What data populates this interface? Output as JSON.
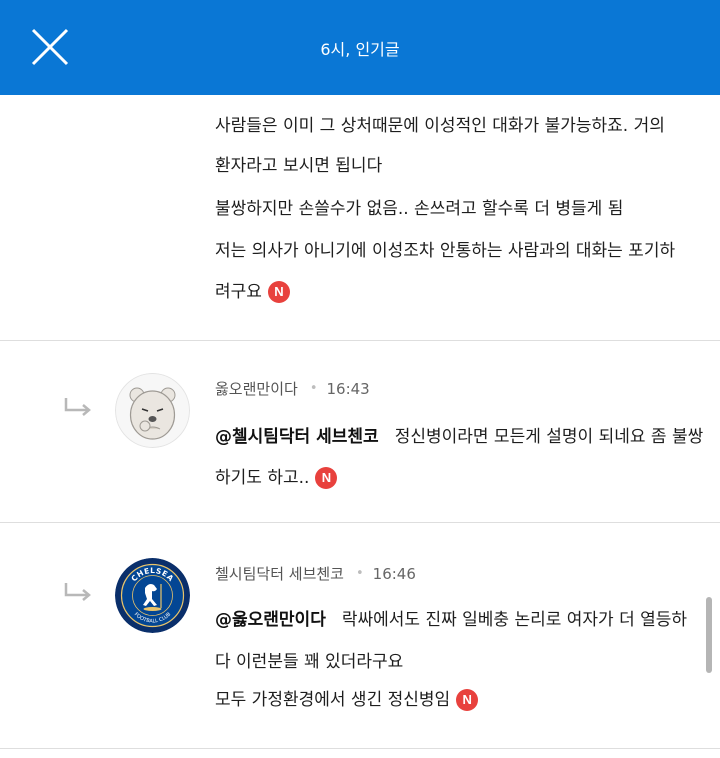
{
  "header": {
    "title": "6시, 인기글",
    "close_icon": "close-icon"
  },
  "comments": [
    {
      "lines": [
        "사람들은 이미 그 상처때문에 이성적인 대화가 불가능하죠. 거의",
        "환자라고 보시면 됩니다",
        "불쌍하지만 손쓸수가 없음.. 손쓰려고 할수록 더 병들게 됨",
        "저는 의사가 아니기에 이성조차 안통하는 사람과의 대화는 포기하",
        "려구요"
      ],
      "new_badge": "N"
    },
    {
      "author": "옳오랜만이다",
      "time": "16:43",
      "avatar": "character-avatar",
      "mention": "@첼시팀닥터 세브첸코",
      "lines": [
        "정신병이라면 모든게 설명이 되네요 좀 불쌍",
        "하기도 하고.."
      ],
      "new_badge": "N"
    },
    {
      "author": "첼시팀닥터 세브첸코",
      "time": "16:46",
      "avatar": "chelsea-crest-avatar",
      "avatar_text": "CHELSEA FOOTBALL CLUB",
      "mention": "@옳오랜만이다",
      "lines": [
        "락싸에서도 진짜 일베충 논리로 여자가 더 열등하",
        "다 이런분들 꽤 있더라구요",
        "모두 가정환경에서 생긴 정신병임"
      ],
      "new_badge": "N"
    }
  ],
  "colors": {
    "header_bg": "#0a77d5",
    "badge": "#e8413d",
    "chelsea_blue": "#034694"
  }
}
